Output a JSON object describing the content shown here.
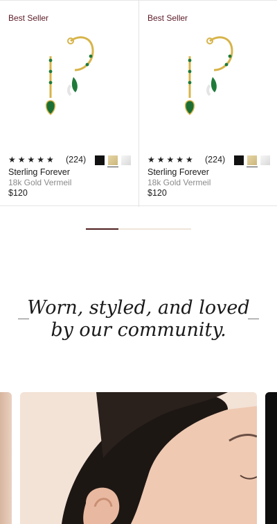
{
  "products": [
    {
      "badge": "Best Seller",
      "rating_count": "(224)",
      "name": "Sterling Forever",
      "material": "18k Gold Vermeil",
      "price": "$120",
      "swatches": [
        "black",
        "gold",
        "silver"
      ],
      "selected_swatch": "gold"
    },
    {
      "badge": "Best Seller",
      "rating_count": "(224)",
      "name": "Sterling Forever",
      "material": "18k Gold Vermeil",
      "price": "$120",
      "swatches": [
        "black",
        "gold",
        "silver"
      ],
      "selected_swatch": "gold"
    }
  ],
  "rating_stars": "★★★★★",
  "pager": {
    "progress": 0.31
  },
  "community": {
    "line1": "Worn, styled, and loved",
    "line2": "by our community."
  },
  "colors": {
    "accent": "#5b1b28",
    "pager_active": "#4e1e1e",
    "pager_track": "#eee5d8"
  }
}
